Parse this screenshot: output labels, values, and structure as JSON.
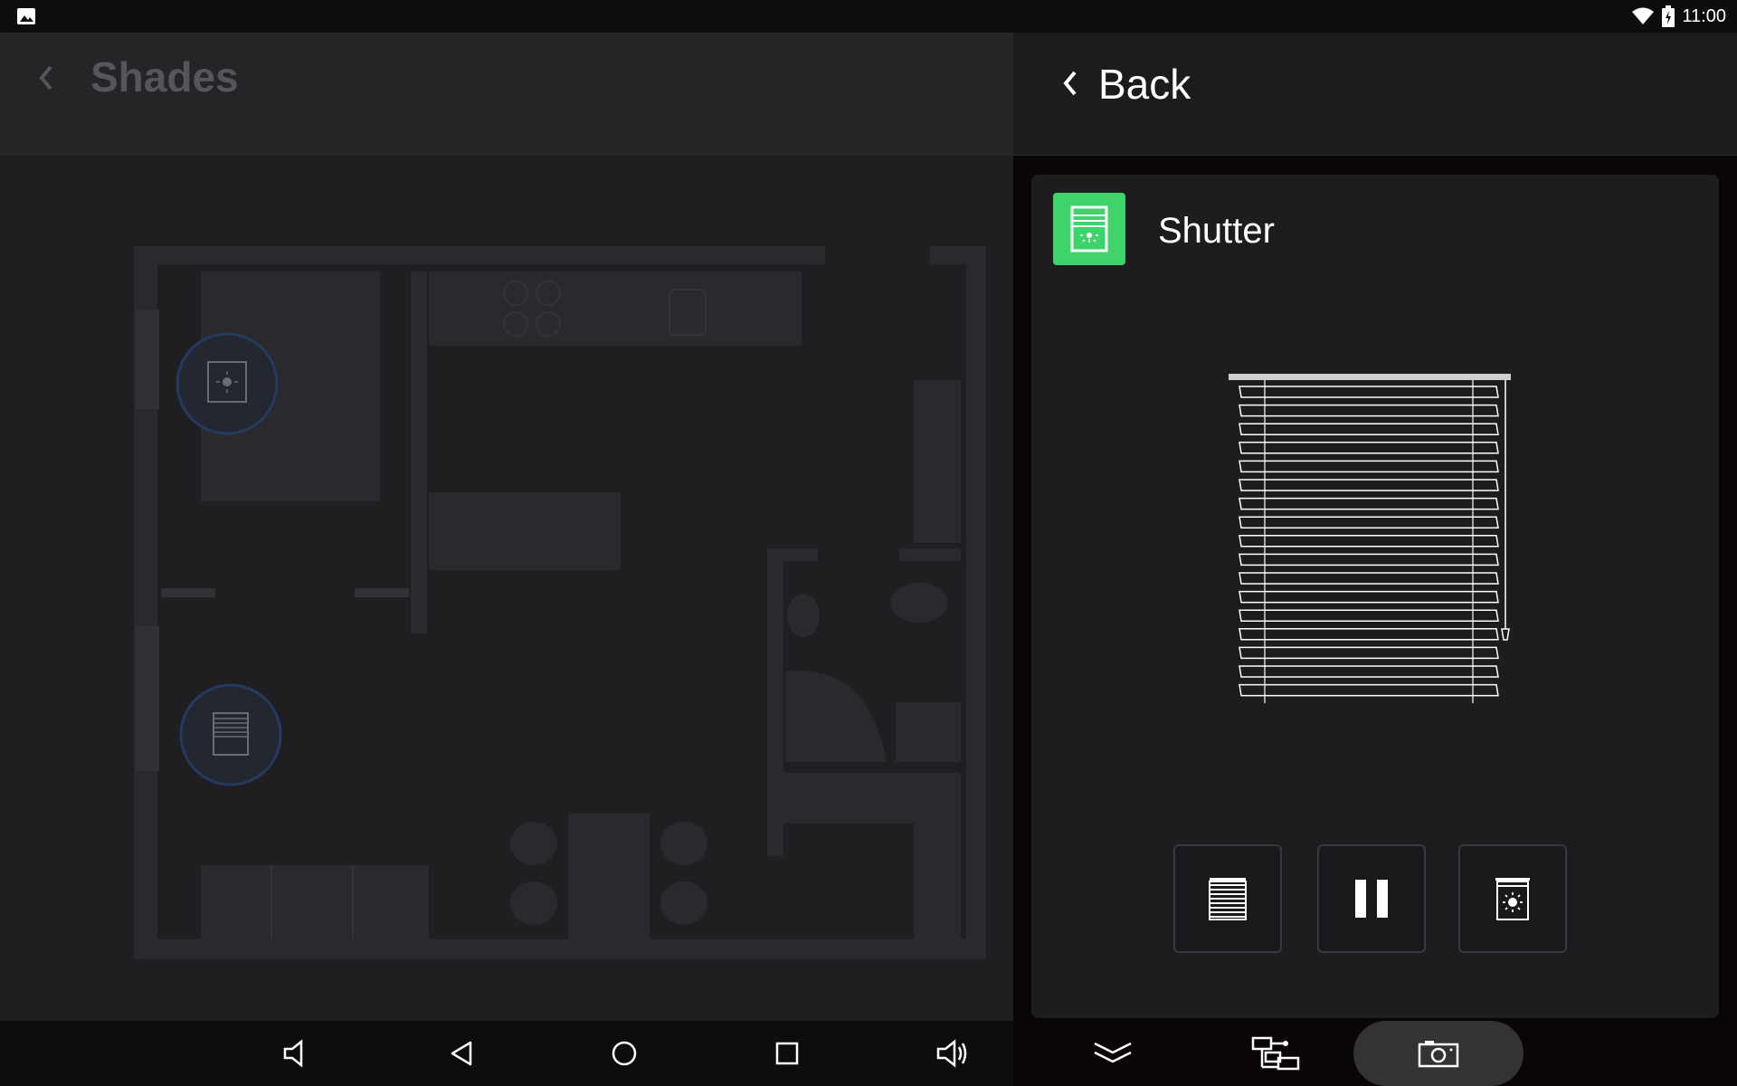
{
  "status_bar": {
    "time": "11:00",
    "left_icon": "image-notification-icon",
    "right_icons": [
      "wifi-icon",
      "battery-charging-icon"
    ]
  },
  "left_pane": {
    "title": "Shades",
    "back_icon": "chevron-left-icon",
    "floorplan_markers": [
      {
        "name": "shade-open-marker",
        "icon": "window-shade-sun-icon"
      },
      {
        "name": "shutter-closed-marker",
        "icon": "window-blind-icon"
      }
    ]
  },
  "right_pane": {
    "back_label": "Back",
    "back_icon": "chevron-left-icon",
    "device": {
      "name": "Shutter",
      "icon": "window-blind-icon",
      "accent_color": "#3ed36b"
    },
    "controls": [
      {
        "name": "close-shutter-button",
        "icon": "blind-closed-icon"
      },
      {
        "name": "pause-button",
        "icon": "pause-icon"
      },
      {
        "name": "open-shutter-button",
        "icon": "blind-open-sun-icon"
      }
    ]
  },
  "left_nav": [
    "volume-down-icon",
    "back-triangle-icon",
    "home-circle-icon",
    "recents-square-icon",
    "volume-up-icon"
  ],
  "right_nav": [
    "collapse-chevrons-icon",
    "network-devices-icon",
    "screenshot-camera-icon"
  ]
}
